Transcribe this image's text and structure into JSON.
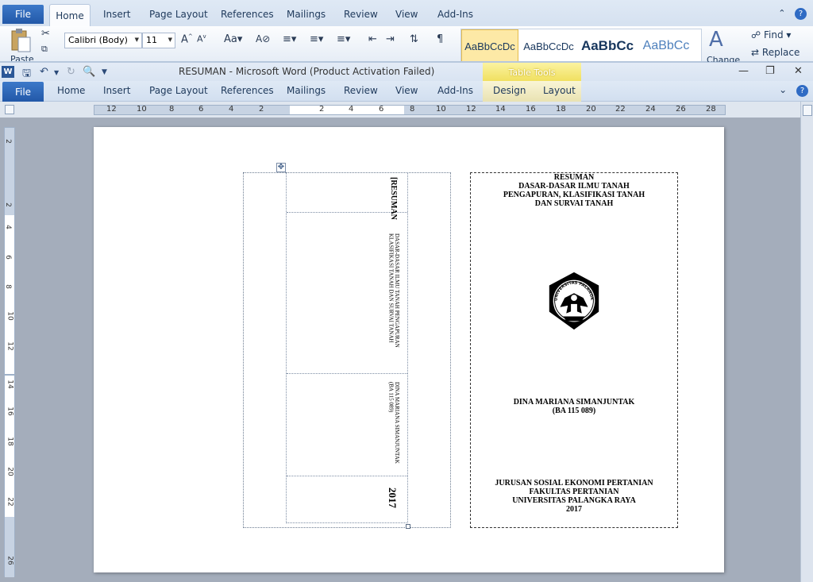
{
  "ghost_window": {
    "file_label": "File",
    "tabs": [
      "Home",
      "Insert",
      "Page Layout",
      "References",
      "Mailings",
      "Review",
      "View",
      "Add-Ins"
    ],
    "paste_label": "Paste",
    "font_name": "Calibri (Body)",
    "font_size": "11",
    "styles": [
      "AaBbCcDc",
      "AaBbCcDc",
      "AaBbCc",
      "AaBbCc"
    ],
    "find_label": "Find",
    "replace_label": "Replace",
    "change_label": "Change"
  },
  "titlebar": {
    "title": "RESUMAN  -  Microsoft Word (Product Activation Failed)",
    "table_tools": "Table Tools"
  },
  "tabs": {
    "file": "File",
    "items": [
      "Home",
      "Insert",
      "Page Layout",
      "References",
      "Mailings",
      "Review",
      "View",
      "Add-Ins"
    ],
    "contextual": [
      "Design",
      "Layout"
    ]
  },
  "ruler": {
    "h_labels": [
      "12",
      "10",
      "8",
      "6",
      "4",
      "2",
      "2",
      "4",
      "6",
      "8",
      "10",
      "12",
      "14",
      "16",
      "18",
      "20",
      "22",
      "24",
      "26",
      "28"
    ],
    "v_labels": [
      "2",
      "2",
      "4",
      "6",
      "8",
      "10",
      "12",
      "14",
      "16",
      "18",
      "20",
      "22",
      "26"
    ]
  },
  "spine": {
    "cells": [
      "[RESUMAN",
      "DASAR-DASAR ILMU TANAH PENGAPURAN\nKLASIFIKASI TANAH DAN SURVAI TANAH",
      "DINA MARIANA SIMANJUNTAK\n(BA 115 089)",
      "2017"
    ]
  },
  "cover": {
    "title_lines": [
      "RESUMAN",
      "DASAR-DASAR ILMU TANAH",
      "PENGAPURAN, KLASIFIKASI TANAH",
      "DAN SURVAI TANAH"
    ],
    "logo_text": "UNIVERSITAS PALANGKA RAYA",
    "author_lines": [
      "DINA MARIANA SIMANJUNTAK",
      "(BA 115 089)"
    ],
    "footer_lines": [
      "JURUSAN SOSIAL EKONOMI PERTANIAN",
      "FAKULTAS PERTANIAN",
      "UNIVERSITAS PALANGKA RAYA",
      "2017"
    ]
  }
}
